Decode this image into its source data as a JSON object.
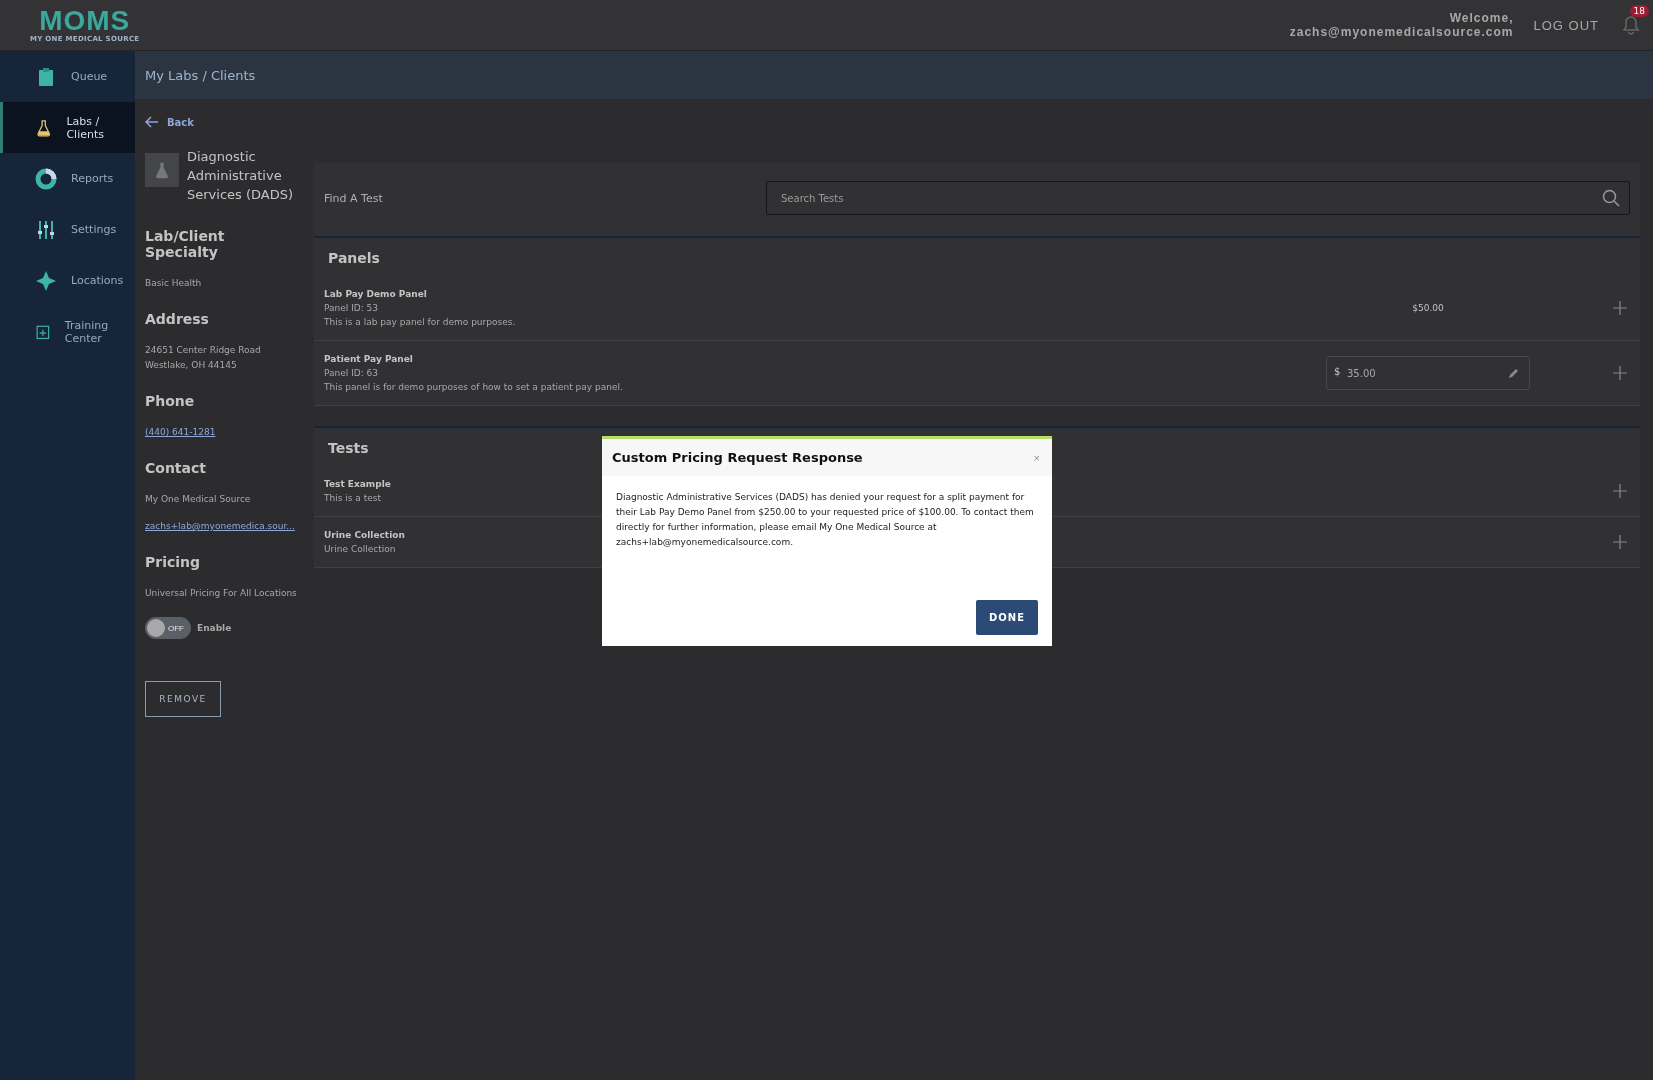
{
  "header": {
    "logo": "MOMS",
    "logo_tagline": "MY ONE MEDICAL SOURCE",
    "welcome": "Welcome,",
    "email": "zachs@myonemedicalsource.com",
    "logout": "LOG OUT",
    "notification_count": "18"
  },
  "sidebar": {
    "items": [
      {
        "label": "Queue",
        "selected": false
      },
      {
        "label": "Labs / Clients",
        "selected": true
      },
      {
        "label": "Reports",
        "selected": false
      },
      {
        "label": "Settings",
        "selected": false
      },
      {
        "label": "Locations",
        "selected": false
      },
      {
        "label": "Training Center",
        "selected": false
      }
    ]
  },
  "breadcrumb": "My Labs / Clients",
  "back": "Back",
  "lab": {
    "name": "Diagnostic Administrative Services (DADS)",
    "sections": [
      {
        "kind": "text",
        "heading": "Lab/Client Specialty",
        "lines": [
          "Basic Health"
        ]
      },
      {
        "kind": "text",
        "heading": "Address",
        "lines": [
          "24651 Center Ridge Road",
          "Westlake, OH 44145"
        ]
      },
      {
        "kind": "links",
        "heading": "Phone",
        "lines": [
          "(440) 641-1281"
        ]
      },
      {
        "kind": "contact",
        "heading": "Contact",
        "lines": [
          "My One Medical Source"
        ],
        "links": [
          "zachs+lab@myonemedica.sour..."
        ]
      },
      {
        "kind": "text",
        "heading": "Pricing",
        "lines": [
          "Universal Pricing For All Locations"
        ]
      }
    ],
    "toggle": {
      "on": false,
      "state_label": "OFF",
      "label": "Enable"
    },
    "remove": "REMOVE"
  },
  "find": {
    "label": "Find A Test",
    "placeholder": "Search Tests"
  },
  "panels": {
    "title": "Panels",
    "rows": [
      {
        "kind": "fixed",
        "name": "Lab Pay Demo Panel",
        "id": "Panel ID: 53",
        "description": "This is a lab pay panel for demo purposes.",
        "price": "$50.00"
      },
      {
        "kind": "editable",
        "name": "Patient Pay Panel",
        "id": "Panel ID: 63",
        "description": "This panel is for demo purposes of how to set a patient pay panel.",
        "currency": "$",
        "price": "35.00"
      }
    ]
  },
  "tests": {
    "title": "Tests",
    "rows": [
      {
        "name": "Test Example",
        "description": "This is a test"
      },
      {
        "name": "Urine Collection",
        "description": "Urine Collection"
      }
    ]
  },
  "modal": {
    "title": "Custom Pricing Request Response",
    "close": "×",
    "body": "Diagnostic Administrative Services (DADS) has denied your request for a split payment for their Lab Pay Demo Panel from $250.00 to your requested price of $100.00. To contact them directly for further information, please email My One Medical Source at zachs+lab@myonemedicalsource.com.",
    "button": "DONE"
  }
}
